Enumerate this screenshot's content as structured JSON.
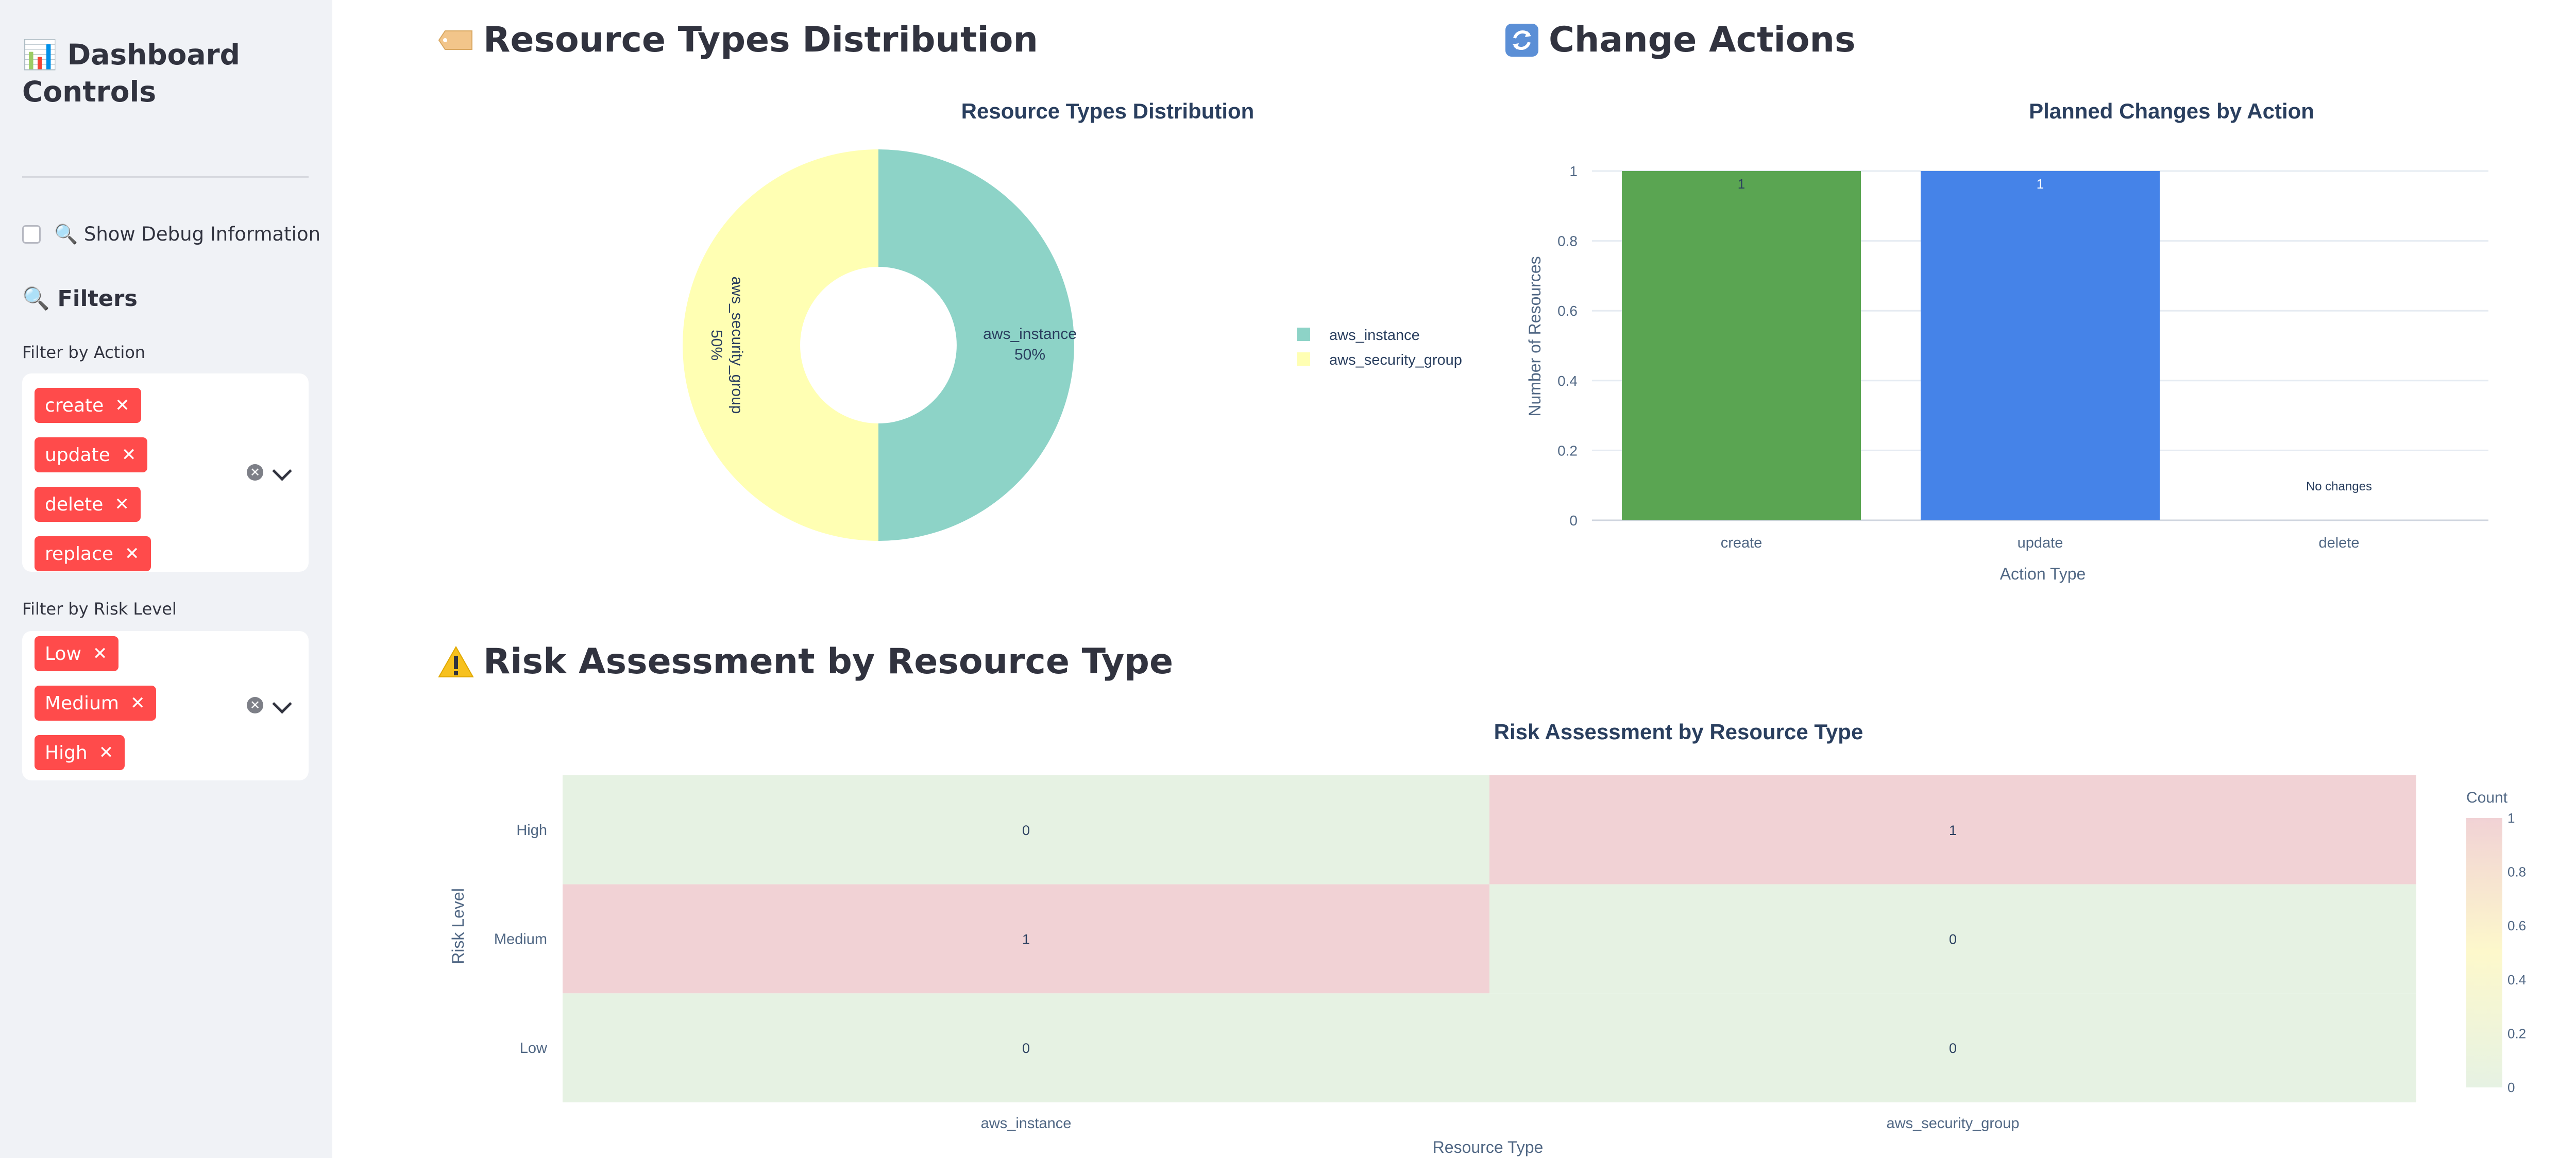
{
  "sidebar": {
    "title": "📊 Dashboard Controls",
    "debug_checkbox_label": "🔍 Show Debug Information",
    "filters_title": "🔍 Filters",
    "action_filter": {
      "label": "Filter by Action",
      "tags": [
        "create",
        "update",
        "delete",
        "replace"
      ]
    },
    "risk_filter": {
      "label": "Filter by Risk Level",
      "tags": [
        "Low",
        "Medium",
        "High"
      ]
    }
  },
  "sections": {
    "resource_types": "Resource Types Distribution",
    "change_actions": "Change Actions",
    "risk_assessment": "Risk Assessment by Resource Type"
  },
  "icons": {
    "resource_types": "label-tag-icon",
    "change_actions": "refresh-cycle-icon",
    "risk_assessment": "warning-icon"
  },
  "chart_data": [
    {
      "type": "pie",
      "title": "Resource Types Distribution",
      "hole": true,
      "slices": [
        {
          "label": "aws_instance",
          "value": 50,
          "text": "50%",
          "color": "#8dd3c7"
        },
        {
          "label": "aws_security_group",
          "value": 50,
          "text": "50%",
          "color": "#ffffb3"
        }
      ],
      "legend": "right"
    },
    {
      "type": "bar",
      "title": "Planned Changes by Action",
      "categories": [
        "create",
        "update",
        "delete"
      ],
      "values": [
        1,
        1,
        0
      ],
      "bar_labels": [
        "1",
        "1",
        ""
      ],
      "colors": [
        "#5aa552",
        "#4583e8",
        "#cccccc"
      ],
      "annotation": "No changes",
      "xlabel": "Action Type",
      "ylabel": "Number of Resources",
      "ylim": [
        0,
        1
      ],
      "yticks": [
        "0",
        "0.2",
        "0.4",
        "0.6",
        "0.8",
        "1"
      ],
      "grid": true
    },
    {
      "type": "heatmap",
      "title": "Risk Assessment by Resource Type",
      "x": [
        "aws_instance",
        "aws_security_group"
      ],
      "y": [
        "High",
        "Medium",
        "Low"
      ],
      "z": [
        [
          0,
          1
        ],
        [
          1,
          0
        ],
        [
          0,
          0
        ]
      ],
      "xlabel": "Resource Type",
      "ylabel": "Risk Level",
      "colorbar_title": "Count",
      "colorbar_ticks": [
        "0",
        "0.2",
        "0.4",
        "0.6",
        "0.8",
        "1"
      ],
      "colorscale": [
        "#e6f2e3",
        "#fdf8cb",
        "#f1d2d5"
      ]
    }
  ]
}
